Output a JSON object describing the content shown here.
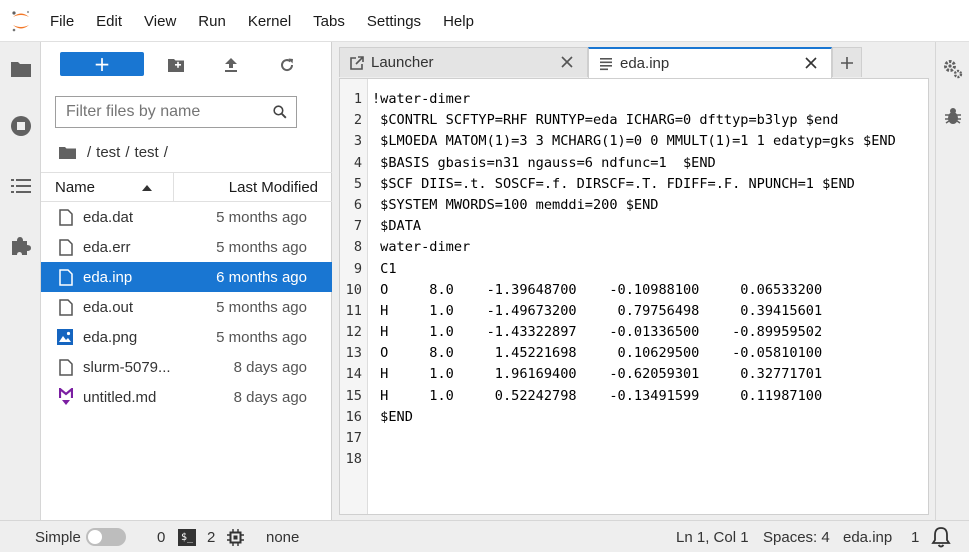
{
  "menubar": {
    "logo_icon": "jupyter-logo",
    "items": [
      "File",
      "Edit",
      "View",
      "Run",
      "Kernel",
      "Tabs",
      "Settings",
      "Help"
    ]
  },
  "activity_bar": {
    "left": [
      "folder-icon",
      "running-icon",
      "toc-icon",
      "extension-icon"
    ],
    "right": [
      "property-inspector-icon",
      "debugger-icon"
    ]
  },
  "filebrowser": {
    "new_button_label": "+",
    "toolbar_icons": [
      "new-folder-icon",
      "upload-icon",
      "refresh-icon"
    ],
    "filter_placeholder": "Filter files by name",
    "breadcrumb": [
      "test",
      "test"
    ],
    "columns": {
      "name": "Name",
      "modified": "Last Modified"
    },
    "files": [
      {
        "name": "eda.dat",
        "modified": "5 months ago",
        "type": "file",
        "selected": false
      },
      {
        "name": "eda.err",
        "modified": "5 months ago",
        "type": "file",
        "selected": false
      },
      {
        "name": "eda.inp",
        "modified": "6 months ago",
        "type": "file",
        "selected": true
      },
      {
        "name": "eda.out",
        "modified": "5 months ago",
        "type": "file",
        "selected": false
      },
      {
        "name": "eda.png",
        "modified": "5 months ago",
        "type": "image",
        "selected": false
      },
      {
        "name": "slurm-5079...",
        "modified": "8 days ago",
        "type": "file",
        "selected": false
      },
      {
        "name": "untitled.md",
        "modified": "8 days ago",
        "type": "markdown",
        "selected": false
      }
    ]
  },
  "tabs": [
    {
      "label": "Launcher",
      "icon": "launcher-icon",
      "active": false
    },
    {
      "label": "eda.inp",
      "icon": "text-file-icon",
      "active": true
    }
  ],
  "editor": {
    "lines": [
      "!water-dimer",
      " $CONTRL SCFTYP=RHF RUNTYP=eda ICHARG=0 dfttyp=b3lyp $end",
      " $LMOEDA MATOM(1)=3 3 MCHARG(1)=0 0 MMULT(1)=1 1 edatyp=gks $END",
      " $BASIS gbasis=n31 ngauss=6 ndfunc=1  $END",
      " $SCF DIIS=.t. SOSCF=.f. DIRSCF=.T. FDIFF=.F. NPUNCH=1 $END",
      " $SYSTEM MWORDS=100 memddi=200 $END",
      " $DATA",
      " water-dimer",
      " C1",
      " O     8.0    -1.39648700    -0.10988100     0.06533200",
      " H     1.0    -1.49673200     0.79756498     0.39415601",
      " H     1.0    -1.43322897    -0.01336500    -0.89959502",
      " O     8.0     1.45221698     0.10629500    -0.05810100",
      " H     1.0     1.96169400    -0.62059301     0.32771701",
      " H     1.0     0.52242798    -0.13491599     0.11987100",
      " $END",
      "",
      ""
    ]
  },
  "statusbar": {
    "mode_label": "Simple",
    "kernels_count": "0",
    "terminals_count": "2",
    "kernel_name": "none",
    "cursor": "Ln 1, Col 1",
    "spaces": "Spaces: 4",
    "filename": "eda.inp",
    "notifications": "1"
  },
  "colors": {
    "accent": "#1976d2",
    "jupyter_orange": "#f37726",
    "markdown_purple": "#7b1fa2"
  }
}
